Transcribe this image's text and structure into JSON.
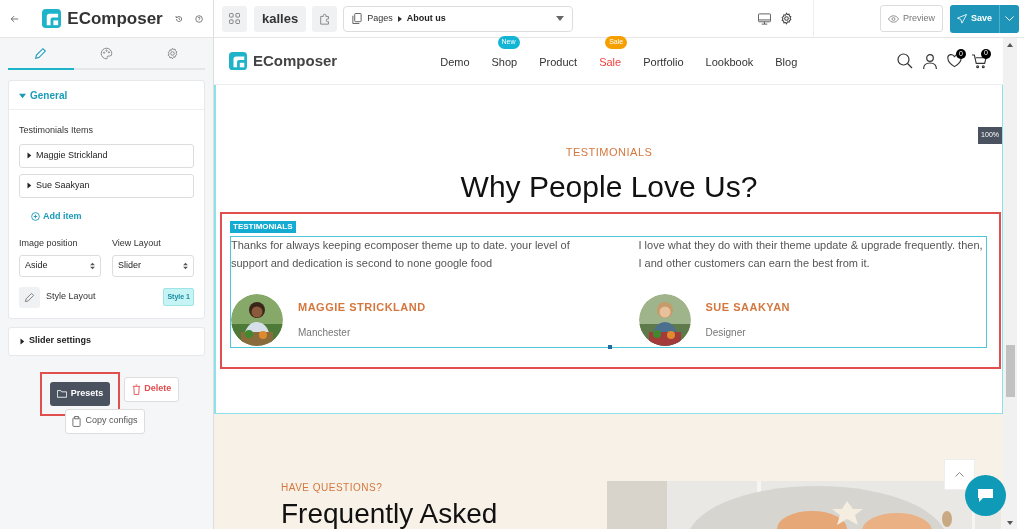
{
  "editor": {
    "brand": "EComposer",
    "store": "kalles",
    "page_select": {
      "section": "Pages",
      "page": "About us"
    },
    "preview": "Preview",
    "save": "Save"
  },
  "sidebar": {
    "tabs": [
      {
        "kind": "pencil",
        "selected": true
      },
      {
        "kind": "palette",
        "selected": false
      },
      {
        "kind": "gear",
        "selected": false
      }
    ],
    "general": {
      "title": "General",
      "expanded": true,
      "items_label": "Testimonials Items",
      "items": [
        {
          "label": "Maggie Strickland",
          "expanded": false
        },
        {
          "label": "Sue Saakyan",
          "expanded": false
        }
      ],
      "add_item": "Add item",
      "image_position": {
        "label": "Image position",
        "value": "Aside"
      },
      "view_layout": {
        "label": "View Layout",
        "value": "Slider"
      },
      "style_layout": {
        "label": "Style Layout",
        "badge": "Style 1"
      }
    },
    "slider_settings": {
      "title": "Slider settings",
      "expanded": false
    },
    "presets": "Presets",
    "delete": "Delete",
    "copy_configs": "Copy configs"
  },
  "canvas": {
    "zoom": "100%",
    "nav": {
      "brand": "EComposer",
      "links": [
        {
          "label": "Demo",
          "highlighted": false
        },
        {
          "label": "Shop",
          "highlighted": false,
          "badge": "New",
          "color": "#12b5d4"
        },
        {
          "label": "Product",
          "highlighted": false
        },
        {
          "label": "Sale",
          "highlighted": true,
          "badge": "Sale",
          "color": "#f5a000"
        },
        {
          "label": "Portfolio",
          "highlighted": false
        },
        {
          "label": "Lookbook",
          "highlighted": false
        },
        {
          "label": "Blog",
          "highlighted": false
        }
      ],
      "wishlist_count": "0",
      "cart_count": "0"
    },
    "testimonials": {
      "eyebrow": "TESTIMONIALS",
      "heading": "Why People Love Us?",
      "tag": "TESTIMONIALS",
      "items": [
        {
          "quote": "Thanks for always keeping ecomposer theme up to date. your level of support and dedication is second to none google food",
          "name": "MAGGIE STRICKLAND",
          "role": "Manchester"
        },
        {
          "quote": "I love what they do with their theme update & upgrade frequently. then, I  and other customers can earn the best from it.",
          "name": "SUE SAAKYAN",
          "role": "Designer"
        }
      ]
    },
    "faq": {
      "eyebrow": "HAVE QUESTIONS?",
      "heading": "Frequently Asked"
    }
  }
}
